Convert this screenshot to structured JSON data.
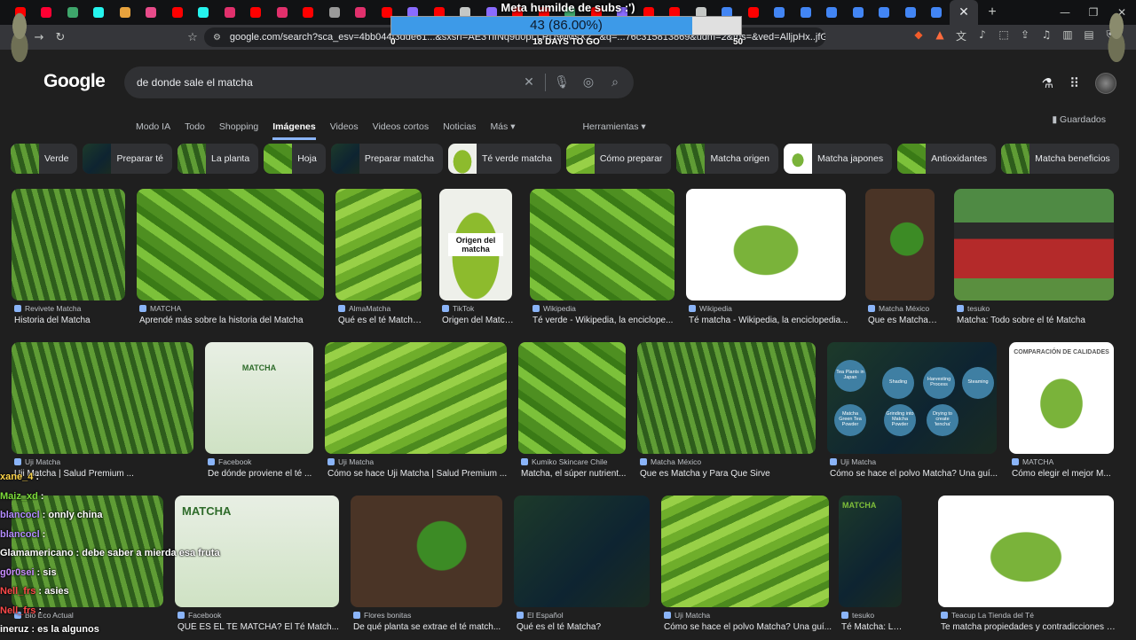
{
  "browser": {
    "tab_count": 37,
    "active_tab_close": "✕",
    "new_tab": "+",
    "url": "google.com/search?sca_esv=4bb044f3dde61...&sxsrf=AE3TifNq9u0pLLRU9vMsX2...&q=...76c315813869&udm=2&tbs=&ved=AlljpHx..jfGojPVHhE..."
  },
  "overlay": {
    "title": "Meta humilde de subs :')",
    "count_label": "43 (86.00%)",
    "progress": 0.86,
    "min": "0",
    "goal_label": "18 DAYS TO GO",
    "max": "50"
  },
  "search": {
    "logo": "Google",
    "query": "de donde sale el matcha"
  },
  "nav": {
    "tabs": [
      "Modo IA",
      "Todo",
      "Shopping",
      "Imágenes",
      "Videos",
      "Videos cortos",
      "Noticias",
      "Más ▾"
    ],
    "active": "Imágenes",
    "tools": "Herramientas ▾",
    "saved": "Guardados"
  },
  "chips": [
    "Verde",
    "Preparar té",
    "La planta",
    "Hoja",
    "Preparar matcha",
    "Té verde matcha",
    "Cómo preparar",
    "Matcha origen",
    "Matcha japones",
    "Antioxidantes",
    "Matcha beneficios"
  ],
  "results": [
    {
      "source": "Revivete Matcha",
      "title": "Historia del Matcha"
    },
    {
      "source": "MATCHA",
      "title": "Aprendé más sobre la historia del Matcha"
    },
    {
      "source": "AlmaMatcha",
      "title": "Qué es el té Matcha..."
    },
    {
      "source": "TikTok",
      "title": "Origen del Matcha:..."
    },
    {
      "source": "Wikipedia",
      "title": "Té verde - Wikipedia, la enciclope..."
    },
    {
      "source": "Wikipedia",
      "title": "Té matcha - Wikipedia, la enciclopedia..."
    },
    {
      "source": "Matcha México",
      "title": "Que es Matcha y P..."
    },
    {
      "source": "tesuko",
      "title": "Matcha: Todo sobre el té Matcha"
    },
    {
      "source": "Uji Matcha",
      "title": "Uji Matcha | Salud Premium ..."
    },
    {
      "source": "Facebook",
      "title": "De dónde proviene el té ..."
    },
    {
      "source": "Uji Matcha",
      "title": "Cómo se hace Uji Matcha | Salud Premium ..."
    },
    {
      "source": "Kumiko Skincare Chile",
      "title": "Matcha, el súper nutrient..."
    },
    {
      "source": "Matcha México",
      "title": "Que es Matcha y Para Que Sirve"
    },
    {
      "source": "Uji Matcha",
      "title": "Cómo se hace el polvo Matcha? Una guí..."
    },
    {
      "source": "MATCHA",
      "title": "Cómo elegir el mejor M..."
    },
    {
      "source": "Bio Eco Actual",
      "title": ""
    },
    {
      "source": "Facebook",
      "title": "QUÉ ES EL TÉ MATCHA? El Té Match..."
    },
    {
      "source": "Flores bonitas",
      "title": "De qué planta se extrae el té match..."
    },
    {
      "source": "El Español",
      "title": "Qué es el té Matcha?"
    },
    {
      "source": "Uji Matcha",
      "title": "Cómo se hace el polvo Matcha? Una guí..."
    },
    {
      "source": "tesuko",
      "title": "Té Matcha: Los 5 ..."
    },
    {
      "source": "Teacup La Tienda del Té",
      "title": "Te matcha propiedades y contradicciones -..."
    }
  ],
  "image_text": {
    "tiktok_caption": "Origen del matcha",
    "infographic_nodes": [
      "Tea Plants in Japan",
      "Shading",
      "Harvesting Process",
      "Steaming",
      "Matcha Green Tea Powder",
      "Grinding into Matcha Powder",
      "Drying to create 'tencha'"
    ],
    "comparison_title": "COMPARACIÓN DE CALIDADES",
    "fb_infographic_title": "MATCHA",
    "tesuko_label": "MATCHA"
  },
  "chat": [
    {
      "user": "xane_4",
      "message": "",
      "color": "#ffd54a"
    },
    {
      "user": "Maiz_xd",
      "message": "",
      "color": "#7ddc3b"
    },
    {
      "user": "blancocl",
      "message": "onnly china",
      "color": "#b38cff"
    },
    {
      "user": "blancocl",
      "message": "",
      "color": "#b38cff"
    },
    {
      "user": "Glamamericano",
      "message": "debe saber a mierda esa fruta",
      "color": "#ffffff"
    },
    {
      "user": "g0r0sei",
      "message": "sis",
      "color": "#c88cff"
    },
    {
      "user": "Nell_frs",
      "message": "asies",
      "color": "#ff4a4a"
    },
    {
      "user": "Nell_frs",
      "message": "",
      "color": "#ff4a4a"
    },
    {
      "user": "ineruz",
      "message": "es la algunos",
      "color": "#ffffff"
    }
  ]
}
